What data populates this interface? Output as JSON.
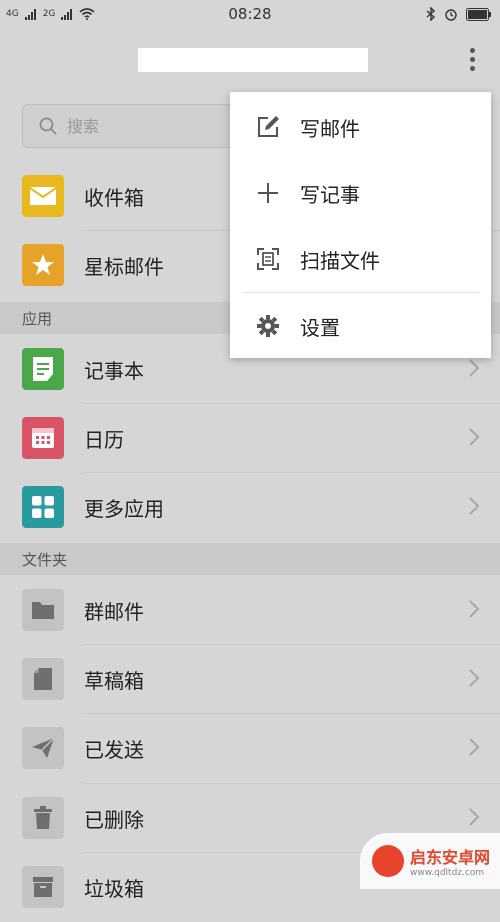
{
  "status_bar": {
    "time": "08:28",
    "signal_1": "4G",
    "signal_2": "2G"
  },
  "search": {
    "placeholder": "搜索"
  },
  "mailboxes": [
    {
      "label": "收件箱",
      "icon": "mail-icon",
      "color": "#e8b91e"
    },
    {
      "label": "星标邮件",
      "icon": "star-icon",
      "color": "#e6a229"
    }
  ],
  "sections": {
    "apps": "应用",
    "folders": "文件夹"
  },
  "apps": [
    {
      "label": "记事本",
      "icon": "notepad-icon",
      "color": "#4aa84a"
    },
    {
      "label": "日历",
      "icon": "calendar-icon",
      "color": "#d85466"
    },
    {
      "label": "更多应用",
      "icon": "grid-icon",
      "color": "#2b9a9e"
    }
  ],
  "folders": [
    {
      "label": "群邮件",
      "icon": "folder-icon"
    },
    {
      "label": "草稿箱",
      "icon": "draft-icon"
    },
    {
      "label": "已发送",
      "icon": "send-icon"
    },
    {
      "label": "已删除",
      "icon": "trash-icon"
    },
    {
      "label": "垃圾箱",
      "icon": "spam-icon"
    }
  ],
  "menu": {
    "items": [
      {
        "label": "写邮件",
        "icon": "compose-icon"
      },
      {
        "label": "写记事",
        "icon": "plus-icon"
      },
      {
        "label": "扫描文件",
        "icon": "scan-icon"
      },
      {
        "label": "设置",
        "icon": "gear-icon"
      }
    ]
  },
  "watermark": {
    "name": "启东安卓网",
    "url": "www.qdltdz.com"
  }
}
